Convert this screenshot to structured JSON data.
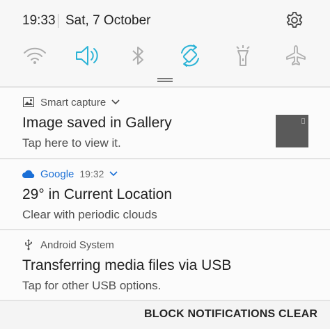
{
  "status": {
    "time": "19:33",
    "date": "Sat, 7 October"
  },
  "quick_settings": [
    {
      "icon": "wifi-icon",
      "active": false
    },
    {
      "icon": "sound-icon",
      "active": true
    },
    {
      "icon": "bluetooth-icon",
      "active": false
    },
    {
      "icon": "auto-rotate-icon",
      "active": true
    },
    {
      "icon": "flashlight-icon",
      "active": false
    },
    {
      "icon": "airplane-mode-icon",
      "active": false
    }
  ],
  "colors": {
    "active": "#2bb3d6",
    "inactive": "#aeaeae",
    "google_blue": "#1a6fd6"
  },
  "notifications": [
    {
      "app": "Smart capture",
      "app_icon": "image-icon",
      "title": "Image saved in Gallery",
      "text": "Tap here to view it."
    },
    {
      "app": "Google",
      "app_icon": "cloud-icon",
      "time": "19:32",
      "title": "29° in Current Location",
      "text": "Clear with periodic clouds"
    },
    {
      "app": "Android System",
      "app_icon": "usb-icon",
      "title": "Transferring media files via USB",
      "text": "Tap for other USB options."
    }
  ],
  "actions": {
    "block": "BLOCK NOTIFICATIONS",
    "clear": "CLEAR"
  }
}
